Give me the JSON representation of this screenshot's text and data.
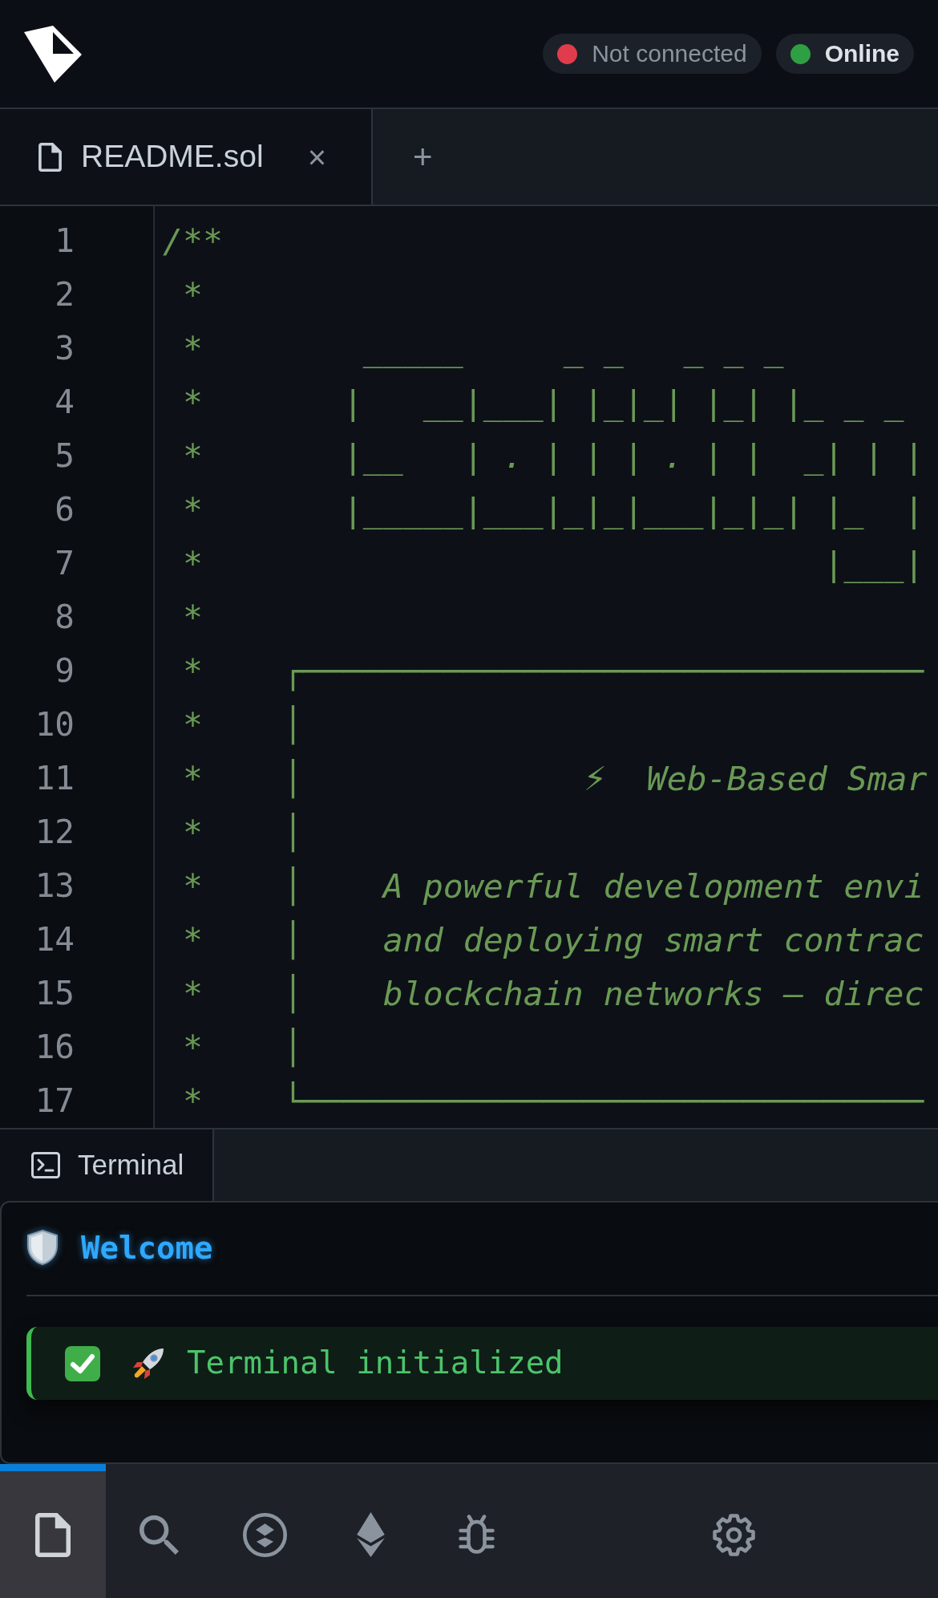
{
  "header": {
    "status_badges": [
      {
        "label": "Not connected",
        "color": "#e03c4c",
        "active": false
      },
      {
        "label": "Online",
        "color": "#2ea043",
        "active": true
      }
    ]
  },
  "editor_tabs": {
    "tabs": [
      {
        "label": "README.sol",
        "selected": true,
        "close": "×"
      }
    ],
    "add": "+"
  },
  "editor": {
    "lines": [
      {
        "number": "1",
        "text": "/**"
      },
      {
        "number": "2",
        "text": " *"
      },
      {
        "number": "3",
        "text": " *        _____     _ _   _ _ _"
      },
      {
        "number": "4",
        "text": " *       |   __|___| |_|_| |_| |_ _ _"
      },
      {
        "number": "5",
        "text": " *       |__   | . | | | . | |  _| | |"
      },
      {
        "number": "6",
        "text": " *       |_____|___|_|_|___|_|_| |_  |"
      },
      {
        "number": "7",
        "text": " *                               |___|"
      },
      {
        "number": "8",
        "text": " *"
      },
      {
        "number": "9",
        "text": " *    ┌───────────────────────────────"
      },
      {
        "number": "10",
        "text": " *    │"
      },
      {
        "number": "11",
        "text": " *    │              ⚡  Web-Based Smar"
      },
      {
        "number": "12",
        "text": " *    │"
      },
      {
        "number": "13",
        "text": " *    │    A powerful development envi"
      },
      {
        "number": "14",
        "text": " *    │    and deploying smart contrac"
      },
      {
        "number": "15",
        "text": " *    │    blockchain networks – direc"
      },
      {
        "number": "16",
        "text": " *    │"
      },
      {
        "number": "17",
        "text": " *    └───────────────────────────────"
      }
    ]
  },
  "terminal": {
    "tabs": [
      {
        "label": "Terminal",
        "selected": true
      }
    ],
    "welcome": "Welcome",
    "messages": [
      {
        "kind": "success",
        "text": "Terminal initialized"
      }
    ]
  },
  "bottom_nav": {
    "items": [
      {
        "kind": "file",
        "selected": true
      },
      {
        "kind": "search",
        "selected": false
      },
      {
        "kind": "stack",
        "selected": false
      },
      {
        "kind": "ethereum",
        "selected": false
      },
      {
        "kind": "bug",
        "selected": false
      }
    ],
    "end_items": [
      {
        "kind": "gear",
        "selected": false
      }
    ]
  }
}
